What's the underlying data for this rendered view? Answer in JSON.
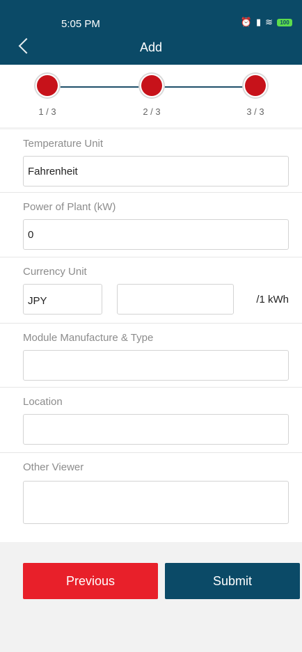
{
  "status": {
    "time": "5:05 PM",
    "battery": "100"
  },
  "header": {
    "title": "Add"
  },
  "stepper": {
    "steps": [
      "1 / 3",
      "2 / 3",
      "3 / 3"
    ],
    "active_color": "#c7121a"
  },
  "form": {
    "temperature": {
      "label": "Temperature Unit",
      "value": "Fahrenheit"
    },
    "power": {
      "label": "Power of Plant (kW)",
      "value": "0"
    },
    "currency": {
      "label": "Currency Unit",
      "unit": "JPY",
      "price": "",
      "suffix": "/1 kWh"
    },
    "module": {
      "label": "Module Manufacture & Type",
      "value": ""
    },
    "location": {
      "label": "Location",
      "value": ""
    },
    "viewer": {
      "label": "Other Viewer",
      "value": ""
    }
  },
  "buttons": {
    "previous": "Previous",
    "submit": "Submit"
  },
  "colors": {
    "header": "#0b4a67",
    "previous": "#e8202a",
    "submit": "#0b4a67"
  }
}
